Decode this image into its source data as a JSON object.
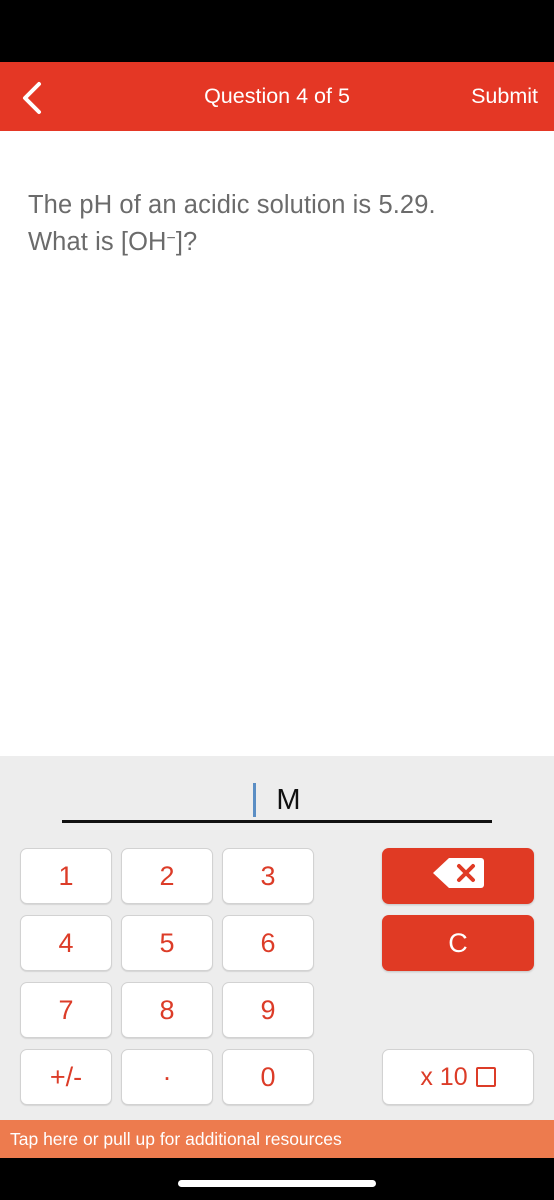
{
  "header": {
    "back_icon": "chevron-left-icon",
    "title": "Question 4 of 5",
    "submit_label": "Submit",
    "background_color": "#E43725"
  },
  "question": {
    "line1": "The pH of an acidic solution is 5.29.",
    "line2_prefix": "What is [OH",
    "line2_sup": "−",
    "line2_suffix": "]?",
    "text_color": "#6B6B6B"
  },
  "answer": {
    "value": "",
    "unit": "M",
    "caret_color": "#5B8EC4"
  },
  "keypad": {
    "background_color": "#EDEDED",
    "digit_color": "#DC3C28",
    "action_color": "#E03A24",
    "keys": [
      {
        "label": "1",
        "name": "key-1"
      },
      {
        "label": "2",
        "name": "key-2"
      },
      {
        "label": "3",
        "name": "key-3"
      },
      {
        "label": "4",
        "name": "key-4"
      },
      {
        "label": "5",
        "name": "key-5"
      },
      {
        "label": "6",
        "name": "key-6"
      },
      {
        "label": "7",
        "name": "key-7"
      },
      {
        "label": "8",
        "name": "key-8"
      },
      {
        "label": "9",
        "name": "key-9"
      },
      {
        "label": "+/-",
        "name": "key-plus-minus"
      },
      {
        "label": ".",
        "name": "key-decimal"
      },
      {
        "label": "0",
        "name": "key-0"
      }
    ],
    "backspace_icon": "backspace-icon",
    "clear_label": "C",
    "exponent_label": "x 10"
  },
  "resources": {
    "label": "Tap here or pull up for additional resources",
    "background_color": "#ED7B4E"
  }
}
